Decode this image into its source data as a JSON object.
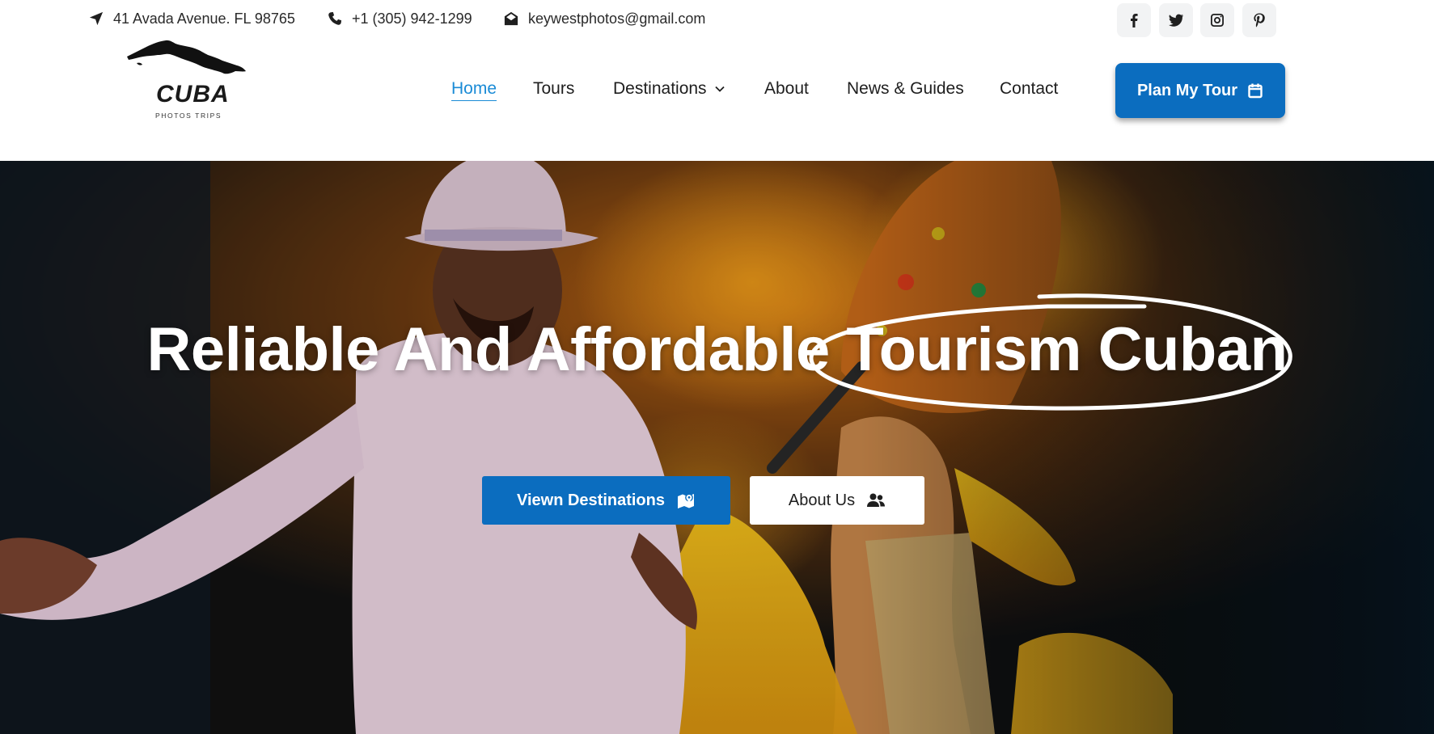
{
  "topbar": {
    "address": "41 Avada Avenue. FL 98765",
    "phone": "+1 (305) 942-1299",
    "email": "keywestphotos@gmail.com",
    "socials": [
      "facebook-icon",
      "twitter-icon",
      "instagram-icon",
      "pinterest-icon"
    ]
  },
  "logo": {
    "word": "CUBA",
    "tagline": "PHOTOS TRIPS"
  },
  "nav": {
    "items": [
      {
        "label": "Home",
        "active": true
      },
      {
        "label": "Tours"
      },
      {
        "label": "Destinations",
        "has_dropdown": true
      },
      {
        "label": "About"
      },
      {
        "label": "News & Guides"
      },
      {
        "label": "Contact"
      }
    ],
    "cta": {
      "label": "Plan My Tour",
      "icon": "calendar-icon"
    }
  },
  "hero": {
    "title_start": "Reliable And Affordable ",
    "title_highlight": "Tourism Cuban",
    "primary_button": {
      "label": "Viewn Destinations",
      "icon": "map-pin-icon"
    },
    "secondary_button": {
      "label": "About Us",
      "icon": "users-icon"
    }
  },
  "colors": {
    "brand_blue": "#0b6dbf",
    "active_link": "#1a8bd6"
  }
}
